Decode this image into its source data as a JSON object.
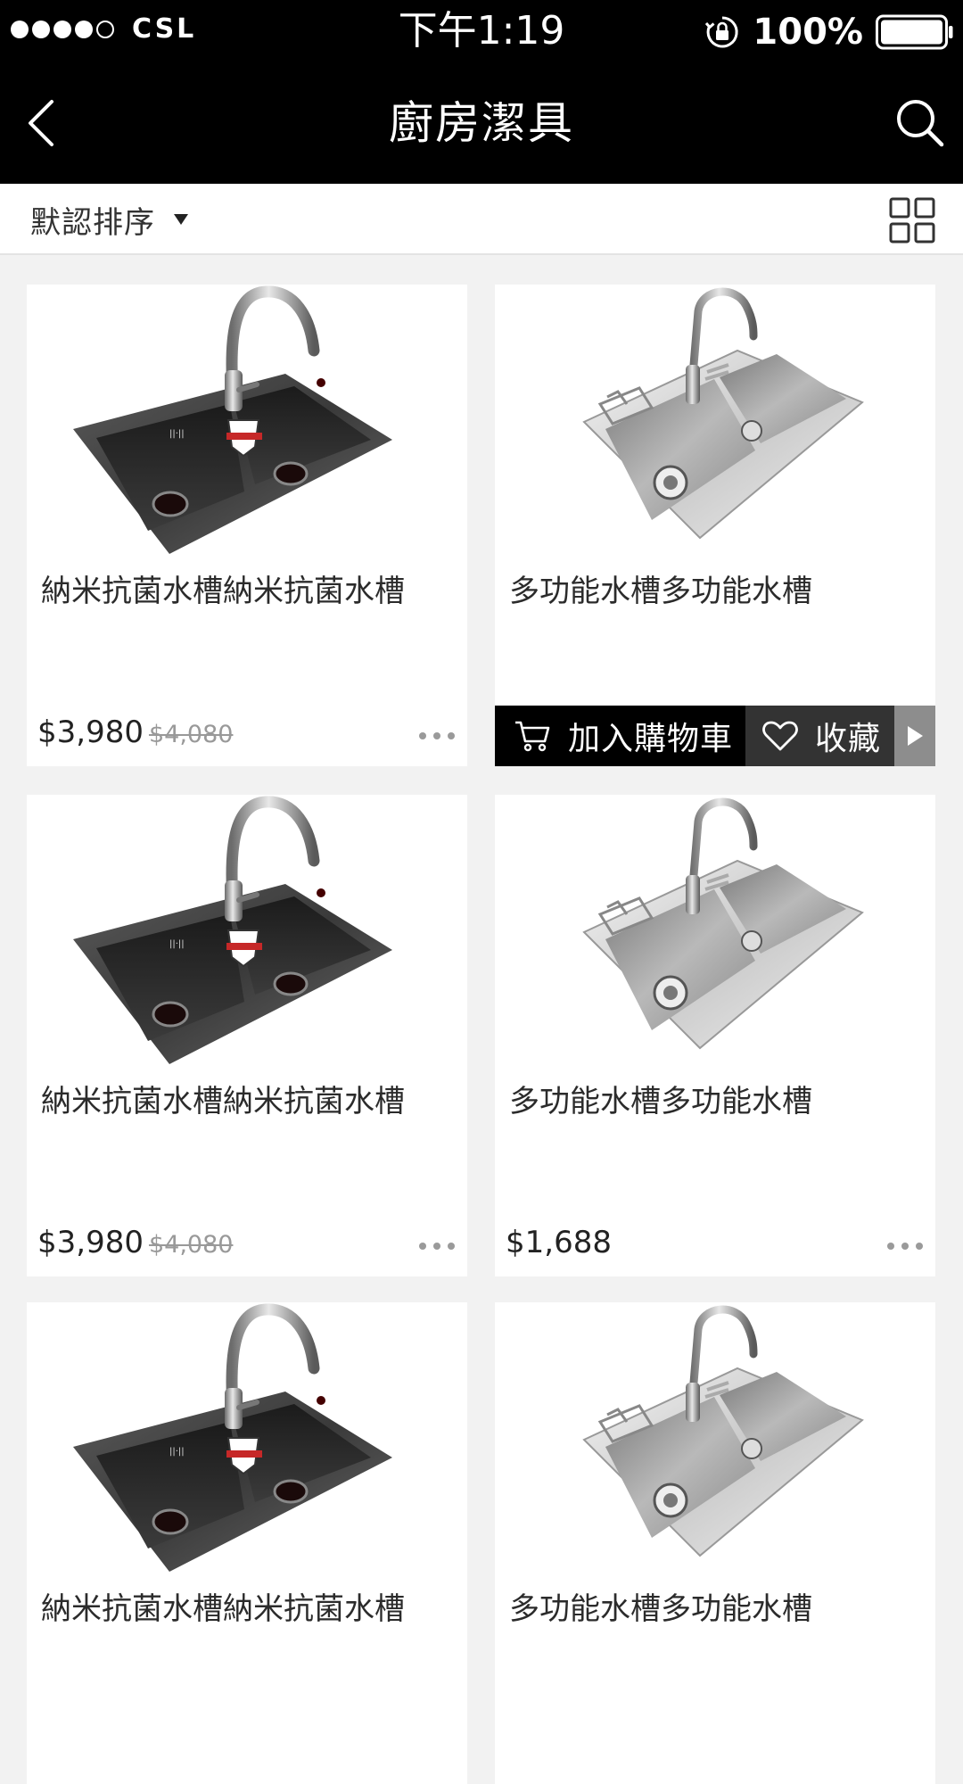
{
  "status_bar": {
    "carrier": "CSL",
    "signal_strength": 4,
    "signal_max": 5,
    "time": "下午1:19",
    "battery_percent": "100%",
    "icons": [
      "rotation-lock-icon",
      "battery-icon"
    ]
  },
  "nav": {
    "title": "廚房潔具",
    "back_icon": "chevron-left-icon",
    "search_icon": "search-icon"
  },
  "sort": {
    "label": "默認排序",
    "caret_icon": "caret-down-icon",
    "view_toggle_icon": "grid-view-icon"
  },
  "products": [
    {
      "name": "納米抗菌水槽納米抗菌水槽",
      "price": "$3,980",
      "original_price": "$4,080",
      "image": "black-sink",
      "show_actions": false
    },
    {
      "name": "多功能水槽多功能水槽",
      "price": "",
      "original_price": "",
      "image": "steel-sink",
      "show_actions": true
    },
    {
      "name": "納米抗菌水槽納米抗菌水槽",
      "price": "$3,980",
      "original_price": "$4,080",
      "image": "black-sink",
      "show_actions": false
    },
    {
      "name": "多功能水槽多功能水槽",
      "price": "$1,688",
      "original_price": "",
      "image": "steel-sink",
      "show_actions": false
    },
    {
      "name": "納米抗菌水槽納米抗菌水槽",
      "price": "",
      "original_price": "",
      "image": "black-sink",
      "show_actions": false
    },
    {
      "name": "多功能水槽多功能水槽",
      "price": "",
      "original_price": "",
      "image": "steel-sink",
      "show_actions": false
    }
  ],
  "actions": {
    "add_to_cart": "加入購物車",
    "favorite": "收藏",
    "cart_icon": "cart-icon",
    "heart_icon": "heart-icon",
    "expand_icon": "play-right-icon"
  },
  "colors": {
    "header_bg": "#000000",
    "page_bg": "#f2f2f2",
    "card_bg": "#ffffff",
    "favorite_bg": "#333333",
    "expand_bg": "#8d8d8d"
  }
}
